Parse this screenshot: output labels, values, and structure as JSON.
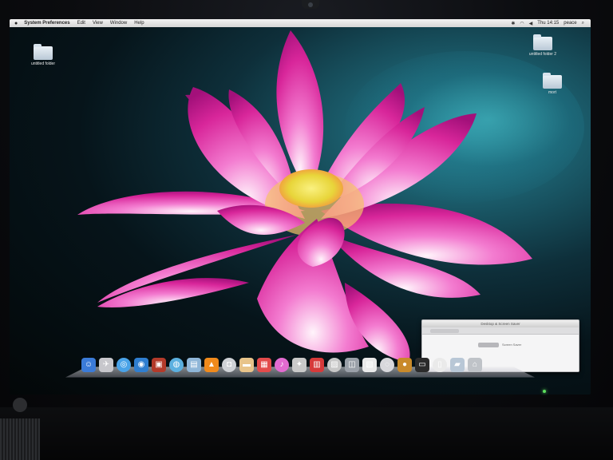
{
  "menubar": {
    "app_name": "System Preferences",
    "items": [
      "Edit",
      "View",
      "Window",
      "Help"
    ],
    "clock": "Thu 14:15",
    "user": "peace"
  },
  "desktop_icons": [
    {
      "label": "untitled folder"
    },
    {
      "label": "untitled folder 2"
    },
    {
      "label": "mort"
    }
  ],
  "dock": {
    "items": [
      {
        "name": "finder-icon",
        "glyph": "☺",
        "color": "#3b7bd8"
      },
      {
        "name": "launchpad-icon",
        "glyph": "✈",
        "color": "#c7c7cc"
      },
      {
        "name": "safari-icon",
        "glyph": "◎",
        "color": "#4aa3e8"
      },
      {
        "name": "globe-icon",
        "glyph": "◉",
        "color": "#2f7ed0"
      },
      {
        "name": "photo-booth-icon",
        "glyph": "▣",
        "color": "#b33a2a"
      },
      {
        "name": "network-icon",
        "glyph": "◍",
        "color": "#5bb0e0"
      },
      {
        "name": "preview-icon",
        "glyph": "▤",
        "color": "#8fb6d8"
      },
      {
        "name": "vlc-icon",
        "glyph": "▲",
        "color": "#f08a1c"
      },
      {
        "name": "camera-icon",
        "glyph": "◘",
        "color": "#cfd2d6"
      },
      {
        "name": "notes-icon",
        "glyph": "▬",
        "color": "#e8c48a"
      },
      {
        "name": "calendar-icon",
        "glyph": "▦",
        "color": "#e34b4b"
      },
      {
        "name": "itunes-icon",
        "glyph": "♪",
        "color": "#e26bd0"
      },
      {
        "name": "rocket-icon",
        "glyph": "✦",
        "color": "#c9c9c9"
      },
      {
        "name": "address-book-icon",
        "glyph": "▥",
        "color": "#d63a3a"
      },
      {
        "name": "photos-icon",
        "glyph": "▨",
        "color": "#c7c7c7"
      },
      {
        "name": "preferences-icon",
        "glyph": "◫",
        "color": "#9aa0a8"
      },
      {
        "name": "document-icon",
        "glyph": "▧",
        "color": "#eaeaea"
      },
      {
        "name": "disk-utility-icon",
        "glyph": "◌",
        "color": "#d8d8dc"
      },
      {
        "name": "coin-icon",
        "glyph": "●",
        "color": "#c98a2a"
      },
      {
        "name": "terminal-icon",
        "glyph": "▭",
        "color": "#2b2b2b"
      },
      {
        "name": "window-thumb-icon",
        "glyph": "▯",
        "color": "#eaeaea"
      },
      {
        "name": "folder-icon",
        "glyph": "▰",
        "color": "#b8c7d6"
      },
      {
        "name": "trash-icon",
        "glyph": "⌂",
        "color": "#bfc3c8"
      }
    ]
  },
  "minimized_window": {
    "title": "Desktop & Screen Saver",
    "label": "Screen Saver"
  },
  "colors": {
    "menubar": "#e4e4e4",
    "petal": "#e0339f",
    "center": "#f4ea5a",
    "desktop_bg": "#0e2f3a"
  }
}
